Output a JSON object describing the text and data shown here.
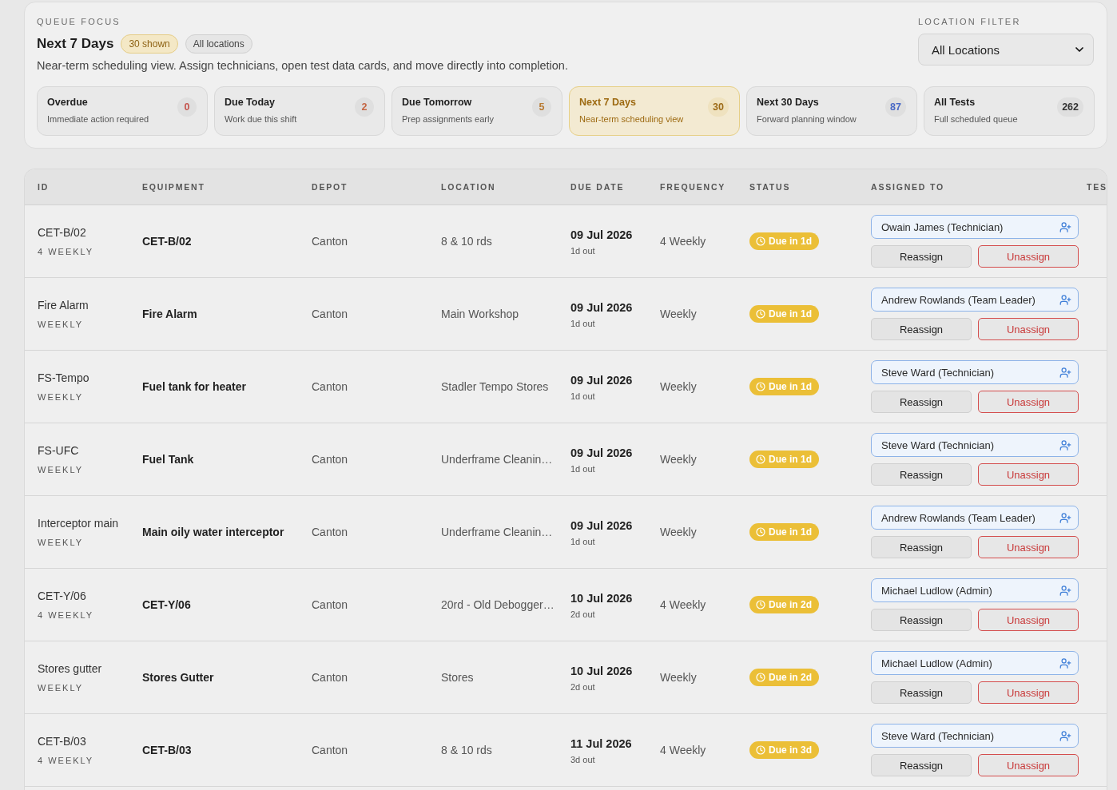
{
  "queue_focus": {
    "eyebrow": "QUEUE FOCUS",
    "title": "Next 7 Days",
    "badges": [
      {
        "label": "30 shown",
        "kind": "highlight"
      },
      {
        "label": "All locations",
        "kind": "neutral"
      }
    ],
    "description": "Near-term scheduling view. Assign technicians, open test data cards, and move directly into completion.",
    "location_filter": {
      "label": "LOCATION FILTER",
      "value": "All Locations"
    },
    "queue_filters": [
      {
        "title": "Overdue",
        "subtitle": "Immediate action required",
        "count": "0",
        "color": "#c4534c",
        "selected": false
      },
      {
        "title": "Due Today",
        "subtitle": "Work due this shift",
        "count": "2",
        "color": "#c46644",
        "selected": false
      },
      {
        "title": "Due Tomorrow",
        "subtitle": "Prep assignments early",
        "count": "5",
        "color": "#b87a32",
        "selected": false
      },
      {
        "title": "Next 7 Days",
        "subtitle": "Near-term scheduling view",
        "count": "30",
        "color": "#9c6a16",
        "selected": true
      },
      {
        "title": "Next 30 Days",
        "subtitle": "Forward planning window",
        "count": "87",
        "color": "#4a69c6",
        "selected": false
      },
      {
        "title": "All Tests",
        "subtitle": "Full scheduled queue",
        "count": "262",
        "color": "#333333",
        "selected": false
      }
    ]
  },
  "table": {
    "columns": [
      "ID",
      "EQUIPMENT",
      "DEPOT",
      "LOCATION",
      "DUE DATE",
      "FREQUENCY",
      "STATUS",
      "ASSIGNED TO",
      "TES"
    ],
    "rows": [
      {
        "id": "CET-B/02",
        "frequency_code": "4 WEEKLY",
        "equipment": "CET-B/02",
        "depot": "Canton",
        "location": "8 & 10 rds",
        "due_date": "09 Jul 2026",
        "due_note": "1d out",
        "frequency": "4 Weekly",
        "status": "Due in 1d",
        "assigned_to": "Owain James (Technician)",
        "actions": [
          {
            "label": "Reassign",
            "kind": "secondary"
          },
          {
            "label": "Unassign",
            "kind": "danger"
          }
        ]
      },
      {
        "id": "Fire Alarm",
        "frequency_code": "WEEKLY",
        "equipment": "Fire Alarm",
        "depot": "Canton",
        "location": "Main Workshop",
        "due_date": "09 Jul 2026",
        "due_note": "1d out",
        "frequency": "Weekly",
        "status": "Due in 1d",
        "assigned_to": "Andrew Rowlands (Team Leader)",
        "actions": [
          {
            "label": "Reassign",
            "kind": "secondary"
          },
          {
            "label": "Unassign",
            "kind": "danger"
          }
        ]
      },
      {
        "id": "FS-Tempo",
        "frequency_code": "WEEKLY",
        "equipment": "Fuel tank for heater",
        "depot": "Canton",
        "location": "Stadler Tempo Stores",
        "due_date": "09 Jul 2026",
        "due_note": "1d out",
        "frequency": "Weekly",
        "status": "Due in 1d",
        "assigned_to": "Steve Ward (Technician)",
        "actions": [
          {
            "label": "Reassign",
            "kind": "secondary"
          },
          {
            "label": "Unassign",
            "kind": "danger"
          }
        ]
      },
      {
        "id": "FS-UFC",
        "frequency_code": "WEEKLY",
        "equipment": "Fuel Tank",
        "depot": "Canton",
        "location": "Underframe Cleanin…",
        "due_date": "09 Jul 2026",
        "due_note": "1d out",
        "frequency": "Weekly",
        "status": "Due in 1d",
        "assigned_to": "Steve Ward (Technician)",
        "actions": [
          {
            "label": "Reassign",
            "kind": "secondary"
          },
          {
            "label": "Unassign",
            "kind": "danger"
          }
        ]
      },
      {
        "id": "Interceptor main",
        "frequency_code": "WEEKLY",
        "equipment": "Main oily water interceptor",
        "depot": "Canton",
        "location": "Underframe Cleanin…",
        "due_date": "09 Jul 2026",
        "due_note": "1d out",
        "frequency": "Weekly",
        "status": "Due in 1d",
        "assigned_to": "Andrew Rowlands (Team Leader)",
        "actions": [
          {
            "label": "Reassign",
            "kind": "secondary"
          },
          {
            "label": "Unassign",
            "kind": "danger"
          }
        ]
      },
      {
        "id": "CET-Y/06",
        "frequency_code": "4 WEEKLY",
        "equipment": "CET-Y/06",
        "depot": "Canton",
        "location": "20rd - Old Debogger…",
        "due_date": "10 Jul 2026",
        "due_note": "2d out",
        "frequency": "4 Weekly",
        "status": "Due in 2d",
        "assigned_to": "Michael Ludlow (Admin)",
        "actions": [
          {
            "label": "Reassign",
            "kind": "secondary"
          },
          {
            "label": "Unassign",
            "kind": "danger"
          }
        ]
      },
      {
        "id": "Stores gutter",
        "frequency_code": "WEEKLY",
        "equipment": "Stores Gutter",
        "depot": "Canton",
        "location": "Stores",
        "due_date": "10 Jul 2026",
        "due_note": "2d out",
        "frequency": "Weekly",
        "status": "Due in 2d",
        "assigned_to": "Michael Ludlow (Admin)",
        "actions": [
          {
            "label": "Reassign",
            "kind": "secondary"
          },
          {
            "label": "Unassign",
            "kind": "danger"
          }
        ]
      },
      {
        "id": "CET-B/03",
        "frequency_code": "4 WEEKLY",
        "equipment": "CET-B/03",
        "depot": "Canton",
        "location": "8 & 10 rds",
        "due_date": "11 Jul 2026",
        "due_note": "3d out",
        "frequency": "4 Weekly",
        "status": "Due in 3d",
        "assigned_to": "Steve Ward (Technician)",
        "actions": [
          {
            "label": "Reassign",
            "kind": "secondary"
          },
          {
            "label": "Unassign",
            "kind": "danger"
          }
        ]
      }
    ]
  }
}
